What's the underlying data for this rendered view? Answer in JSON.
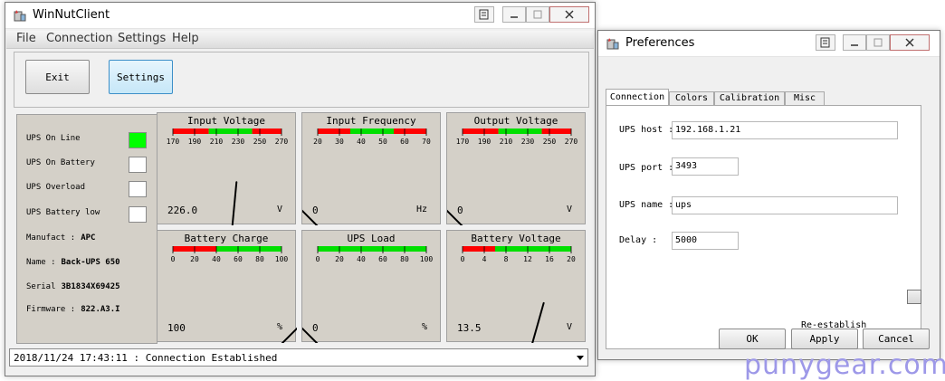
{
  "main_window": {
    "title": "WinNutClient",
    "menu": [
      "File",
      "Connection",
      "Settings",
      "Help"
    ],
    "toolbar": {
      "exit_label": "Exit",
      "settings_label": "Settings"
    },
    "status_indicators": [
      {
        "label": "UPS On Line",
        "active": true,
        "color": "#00ff00"
      },
      {
        "label": "UPS On Battery",
        "active": false
      },
      {
        "label": "UPS Overload",
        "active": false
      },
      {
        "label": "UPS Battery low",
        "active": false
      }
    ],
    "info": {
      "manufact_label": "Manufact :",
      "manufact_value": "APC",
      "name_label": "Name :",
      "name_value": "Back-UPS 650",
      "serial_label": "Serial",
      "serial_value": "3B1834X69425",
      "firmware_label": "Firmware :",
      "firmware_value": "822.A3.I"
    },
    "gauges": [
      {
        "title": "Input Voltage",
        "ticks": [
          "170",
          "190",
          "210",
          "230",
          "250",
          "270"
        ],
        "min": 170,
        "max": 270,
        "bands": [
          [
            "red",
            0,
            0.33
          ],
          [
            "green",
            0.33,
            0.73
          ],
          [
            "red",
            0.73,
            1
          ]
        ],
        "value": 226.0,
        "value_text": "226.0",
        "unit": "V"
      },
      {
        "title": "Input Frequency",
        "ticks": [
          "20",
          "30",
          "40",
          "50",
          "60",
          "70"
        ],
        "min": 20,
        "max": 70,
        "bands": [
          [
            "red",
            0,
            0.3
          ],
          [
            "green",
            0.3,
            0.7
          ],
          [
            "red",
            0.7,
            1
          ]
        ],
        "value": 0,
        "value_text": "0",
        "unit": "Hz"
      },
      {
        "title": "Output Voltage",
        "ticks": [
          "170",
          "190",
          "210",
          "230",
          "250",
          "270"
        ],
        "min": 170,
        "max": 270,
        "bands": [
          [
            "red",
            0,
            0.33
          ],
          [
            "green",
            0.33,
            0.73
          ],
          [
            "red",
            0.73,
            1
          ]
        ],
        "value": 0,
        "value_text": "0",
        "unit": "V"
      },
      {
        "title": "Battery Charge",
        "ticks": [
          "0",
          "20",
          "40",
          "60",
          "80",
          "100"
        ],
        "min": 0,
        "max": 100,
        "bands": [
          [
            "red",
            0,
            0.4
          ],
          [
            "green",
            0.4,
            1
          ]
        ],
        "value": 100,
        "value_text": "100",
        "unit": "%"
      },
      {
        "title": "UPS Load",
        "ticks": [
          "0",
          "20",
          "40",
          "60",
          "80",
          "100"
        ],
        "min": 0,
        "max": 100,
        "bands": [
          [
            "green",
            0,
            1
          ]
        ],
        "value": 0,
        "value_text": "0",
        "unit": "%"
      },
      {
        "title": "Battery Voltage",
        "ticks": [
          "0",
          "4",
          "8",
          "12",
          "16",
          "20"
        ],
        "min": 0,
        "max": 20,
        "bands": [
          [
            "red",
            0,
            0.3
          ],
          [
            "green",
            0.3,
            1
          ]
        ],
        "value": 13.5,
        "value_text": "13.5",
        "unit": "V"
      }
    ],
    "log": "2018/11/24 17:43:11 : Connection Established"
  },
  "preferences": {
    "title": "Preferences",
    "tabs": [
      "Connection",
      "Colors",
      "Calibration",
      "Misc"
    ],
    "fields": {
      "host_label": "UPS host :",
      "host_value": "192.168.1.21",
      "port_label": "UPS port :",
      "port_value": "3493",
      "name_label": "UPS name :",
      "name_value": "ups",
      "delay_label": "Delay :",
      "delay_value": "5000"
    },
    "reestablish_label": "Re-establish",
    "buttons": {
      "ok": "OK",
      "apply": "Apply",
      "cancel": "Cancel"
    }
  },
  "watermark": "punygear.com",
  "colors": {
    "gauge_bg": "#d4d0c8",
    "band_red": "#ff0000",
    "band_green": "#00e000",
    "online_green": "#00ff00"
  }
}
